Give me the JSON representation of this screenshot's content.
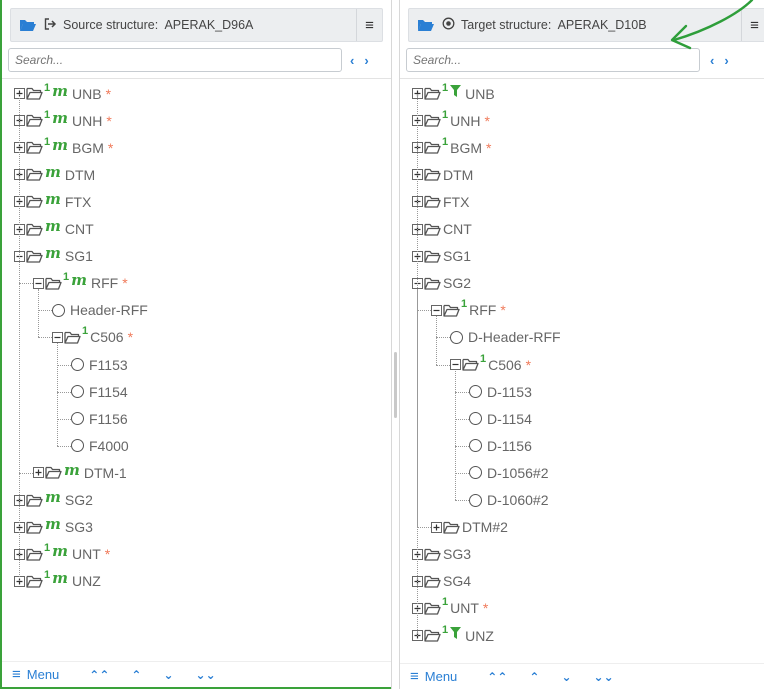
{
  "left": {
    "title_prefix": "Source structure:",
    "title_value": "APERAK_D96A",
    "search_placeholder": "Search...",
    "nav_prev": "‹",
    "nav_next": "›",
    "menu_label": "Menu",
    "rows": [
      {
        "label": "UNB",
        "req": "*",
        "sup": "1",
        "mark": "m"
      },
      {
        "label": "UNH",
        "req": "*",
        "sup": "1",
        "mark": "m"
      },
      {
        "label": "BGM",
        "req": "*",
        "sup": "1",
        "mark": "m"
      },
      {
        "label": "DTM",
        "req": "",
        "sup": "",
        "mark": "m"
      },
      {
        "label": "FTX",
        "req": "",
        "sup": "",
        "mark": "m"
      },
      {
        "label": "CNT",
        "req": "",
        "sup": "",
        "mark": "m"
      },
      {
        "label": "SG1",
        "req": "",
        "sup": "",
        "mark": "m"
      },
      {
        "label": "RFF",
        "req": "*",
        "sup": "1",
        "mark": "m"
      },
      {
        "label": "Header-RFF",
        "req": ""
      },
      {
        "label": "C506",
        "req": "*",
        "sup": "1",
        "mark": ""
      },
      {
        "label": "F1153",
        "req": ""
      },
      {
        "label": "F1154",
        "req": ""
      },
      {
        "label": "F1156",
        "req": ""
      },
      {
        "label": "F4000",
        "req": ""
      },
      {
        "label": "DTM-1",
        "req": "",
        "sup": "",
        "mark": "m"
      },
      {
        "label": "SG2",
        "req": "",
        "sup": "",
        "mark": "m"
      },
      {
        "label": "SG3",
        "req": "",
        "sup": "",
        "mark": "m"
      },
      {
        "label": "UNT",
        "req": "*",
        "sup": "1",
        "mark": "m"
      },
      {
        "label": "UNZ",
        "req": "",
        "sup": "1",
        "mark": "m"
      }
    ]
  },
  "right": {
    "title_prefix": "Target structure:",
    "title_value": "APERAK_D10B",
    "search_placeholder": "Search...",
    "nav_prev": "‹",
    "nav_next": "›",
    "menu_label": "Menu",
    "rows": [
      {
        "label": "UNB",
        "req": "",
        "sup": "1",
        "mark": "filter"
      },
      {
        "label": "UNH",
        "req": "*",
        "sup": "1",
        "mark": ""
      },
      {
        "label": "BGM",
        "req": "*",
        "sup": "1",
        "mark": ""
      },
      {
        "label": "DTM",
        "req": "",
        "sup": "",
        "mark": ""
      },
      {
        "label": "FTX",
        "req": "",
        "sup": "",
        "mark": ""
      },
      {
        "label": "CNT",
        "req": "",
        "sup": "",
        "mark": ""
      },
      {
        "label": "SG1",
        "req": "",
        "sup": "",
        "mark": ""
      },
      {
        "label": "SG2",
        "req": "",
        "sup": "",
        "mark": ""
      },
      {
        "label": "RFF",
        "req": "*",
        "sup": "1",
        "mark": ""
      },
      {
        "label": "D-Header-RFF",
        "req": ""
      },
      {
        "label": "C506",
        "req": "*",
        "sup": "1",
        "mark": ""
      },
      {
        "label": "D-1153",
        "req": ""
      },
      {
        "label": "D-1154",
        "req": ""
      },
      {
        "label": "D-1156",
        "req": ""
      },
      {
        "label": "D-1056#2",
        "req": ""
      },
      {
        "label": "D-1060#2",
        "req": ""
      },
      {
        "label": "DTM#2",
        "req": "",
        "sup": "",
        "mark": ""
      },
      {
        "label": "SG3",
        "req": "",
        "sup": "",
        "mark": ""
      },
      {
        "label": "SG4",
        "req": "",
        "sup": "",
        "mark": ""
      },
      {
        "label": "UNT",
        "req": "*",
        "sup": "1",
        "mark": ""
      },
      {
        "label": "UNZ",
        "req": "",
        "sup": "1",
        "mark": "filter"
      }
    ]
  },
  "colors": {
    "accent_green": "#3aa23a",
    "link_blue": "#2a7fd4",
    "required_orange": "#f07a5a",
    "folder_blue": "#2a7fd4"
  },
  "icons": {
    "header_folder": "folder-open-icon",
    "source_direction": "arrow-right-from-bracket-icon",
    "target_direction": "circle-dot-icon",
    "hamburger": "hamburger-icon",
    "mapped": "mapped-m-icon",
    "filter": "filter-icon"
  }
}
